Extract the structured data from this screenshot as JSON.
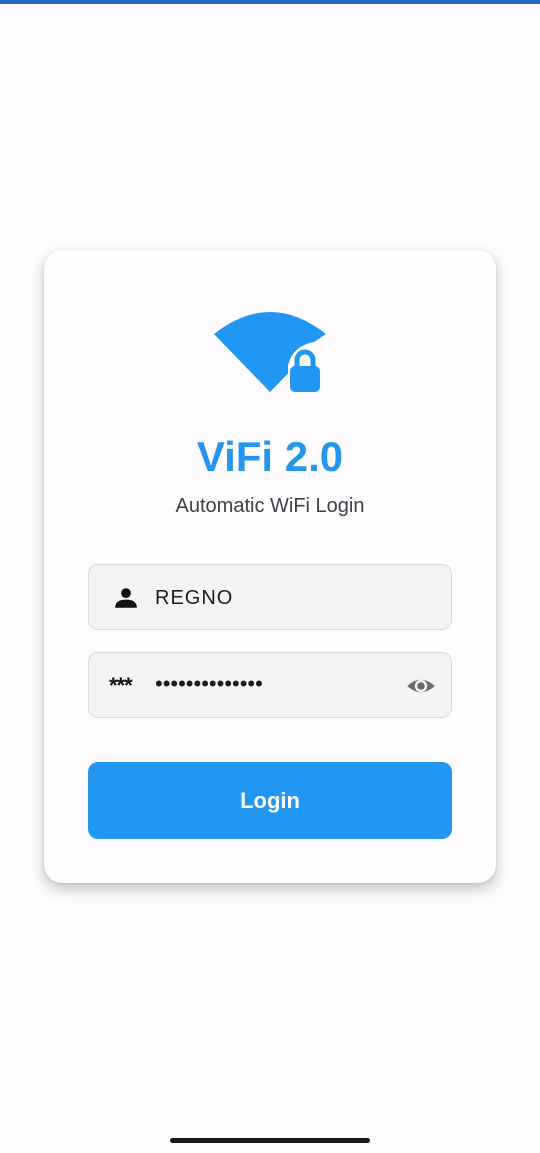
{
  "app": {
    "title": "ViFi 2.0",
    "subtitle": "Automatic WiFi Login"
  },
  "form": {
    "username": {
      "value": "REGNO",
      "icon": "person-icon"
    },
    "password": {
      "lead_text": "***",
      "value": "••••••••••••••",
      "icon": "eye-icon"
    },
    "login_label": "Login"
  },
  "colors": {
    "accent": "#2296f3",
    "title": "#2596ee",
    "top_bar": "#1e6fc4"
  }
}
